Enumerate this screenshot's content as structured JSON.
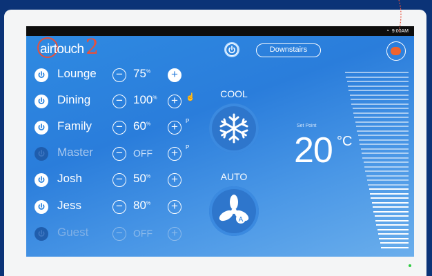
{
  "status_bar": {
    "time": "9:00AM"
  },
  "logo": {
    "text": "airtouch",
    "version": "2"
  },
  "header": {
    "zone_selector": "Downstairs"
  },
  "zones": [
    {
      "name": "Lounge",
      "value": "75",
      "unit": "%",
      "state": "on",
      "plus_style": "filled",
      "flag": ""
    },
    {
      "name": "Dining",
      "value": "100",
      "unit": "%",
      "state": "on",
      "plus_style": "outline",
      "flag": "hand"
    },
    {
      "name": "Family",
      "value": "60",
      "unit": "%",
      "state": "on",
      "plus_style": "outline",
      "flag": "P"
    },
    {
      "name": "Master",
      "value": "OFF",
      "unit": "",
      "state": "off",
      "plus_style": "outline",
      "flag": "P"
    },
    {
      "name": "Josh",
      "value": "50",
      "unit": "%",
      "state": "on",
      "plus_style": "outline",
      "flag": ""
    },
    {
      "name": "Jess",
      "value": "80",
      "unit": "%",
      "state": "on",
      "plus_style": "outline",
      "flag": ""
    },
    {
      "name": "Guest",
      "value": "OFF",
      "unit": "",
      "state": "disabled",
      "plus_style": "outline",
      "flag": ""
    }
  ],
  "mode": {
    "label": "COOL",
    "icon": "snowflake-icon"
  },
  "fan": {
    "label": "AUTO",
    "icon": "fan-icon",
    "badge": "A"
  },
  "setpoint": {
    "label": "Set Point",
    "value": "20",
    "unit": "°C",
    "level": 0.35
  },
  "colors": {
    "accent": "#2a7ddb",
    "brand_red": "#e8503a",
    "orange": "#f0632d"
  }
}
